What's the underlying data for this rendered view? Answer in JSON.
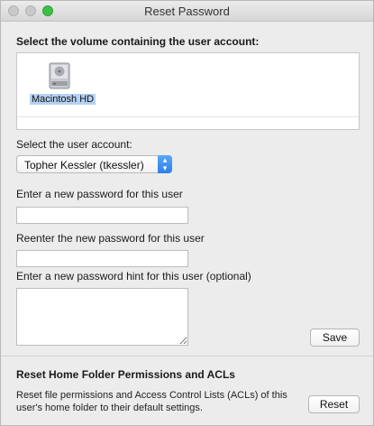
{
  "window": {
    "title": "Reset Password"
  },
  "volume_section": {
    "heading": "Select the volume containing the user account:",
    "volumes": [
      {
        "label": "Macintosh HD",
        "icon": "hard-drive-icon",
        "selected": true
      }
    ]
  },
  "user_section": {
    "label": "Select the user account:",
    "selected_user": "Topher Kessler (tkessler)"
  },
  "password_section": {
    "new_password_label": "Enter a new password for this user",
    "new_password_value": "",
    "reenter_label": "Reenter the new password for this user",
    "reenter_value": "",
    "hint_label": "Enter a new password hint for this user (optional)",
    "hint_value": "",
    "save_label": "Save"
  },
  "permissions_section": {
    "heading": "Reset Home Folder Permissions and ACLs",
    "description": "Reset file permissions and Access Control Lists (ACLs) of this user's home folder to their default settings.",
    "reset_label": "Reset"
  },
  "colors": {
    "selection": "#b5d1f3",
    "accent": "#3b8ff0",
    "zoom": "#3fbf4a"
  }
}
